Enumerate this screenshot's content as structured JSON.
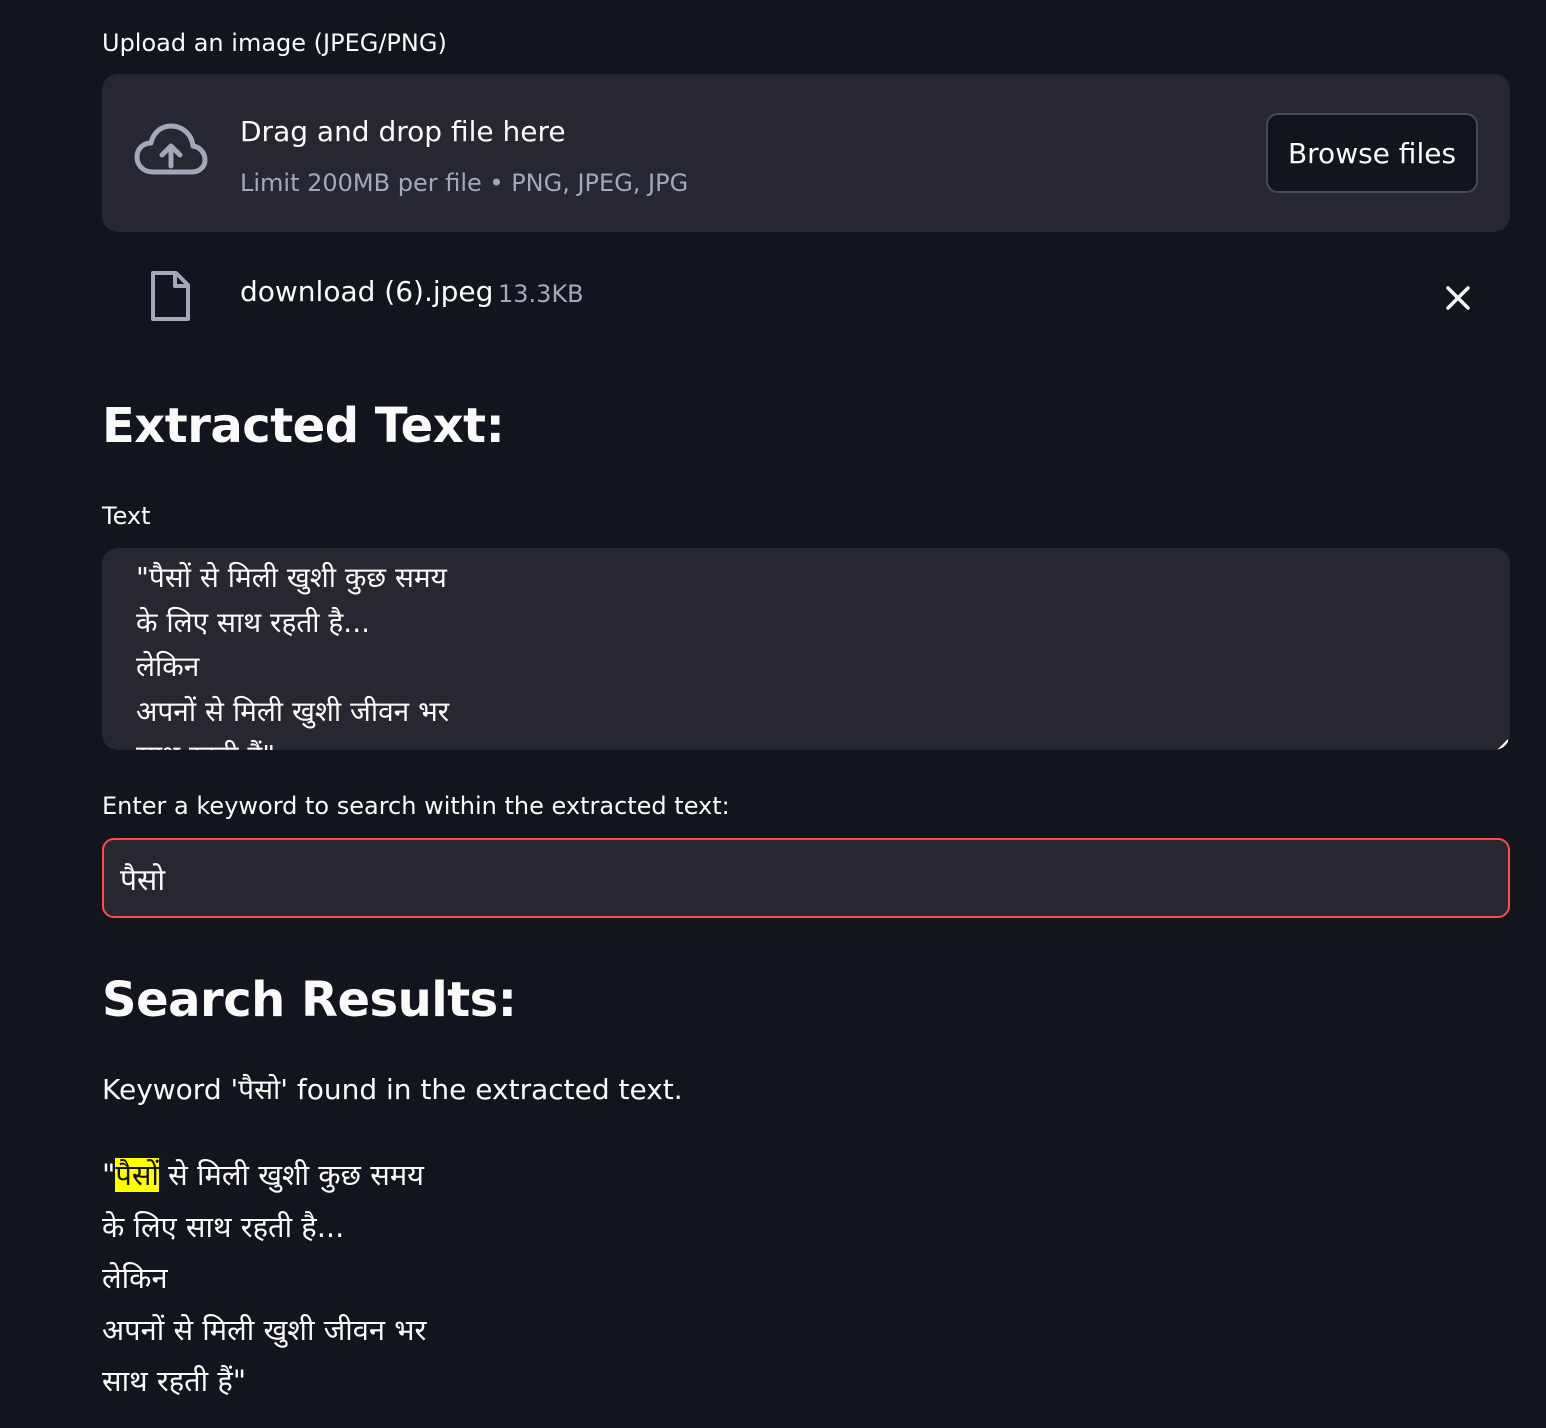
{
  "uploader": {
    "label": "Upload an image (JPEG/PNG)",
    "drop_title": "Drag and drop file here",
    "drop_subtitle": "Limit 200MB per file • PNG, JPEG, JPG",
    "browse_label": "Browse files",
    "icon": "cloud-upload-icon"
  },
  "file": {
    "name": "download (6).jpeg",
    "size": "13.3KB",
    "icon": "file-icon",
    "remove_icon": "close-icon"
  },
  "extracted": {
    "heading": "Extracted Text:",
    "field_label": "Text",
    "value": "\"पैसों से मिली खुशी कुछ समय\nके लिए साथ रहती है...\nलेकिन\nअपनों से मिली खुशी जीवन भर\nसाथ रहती हैं\""
  },
  "search": {
    "label": "Enter a keyword to search within the extracted text:",
    "value": "पैसो"
  },
  "results": {
    "heading": "Search Results:",
    "message": "Keyword 'पैसो' found in the extracted text.",
    "line1_prefix": "\"",
    "line1_highlight": "पैसों",
    "line1_rest": " से मिली खुशी कुछ समय",
    "line2": "के लिए साथ रहती है...",
    "line3": "लेकिन",
    "line4": "अपनों से मिली खुशी जीवन भर",
    "line5": "साथ रहती हैं\""
  },
  "colors": {
    "background": "#12151d",
    "panel": "#262730",
    "accent_border": "#ff4b4b",
    "highlight": "#ffff00",
    "muted_text": "#a3a8b8"
  }
}
